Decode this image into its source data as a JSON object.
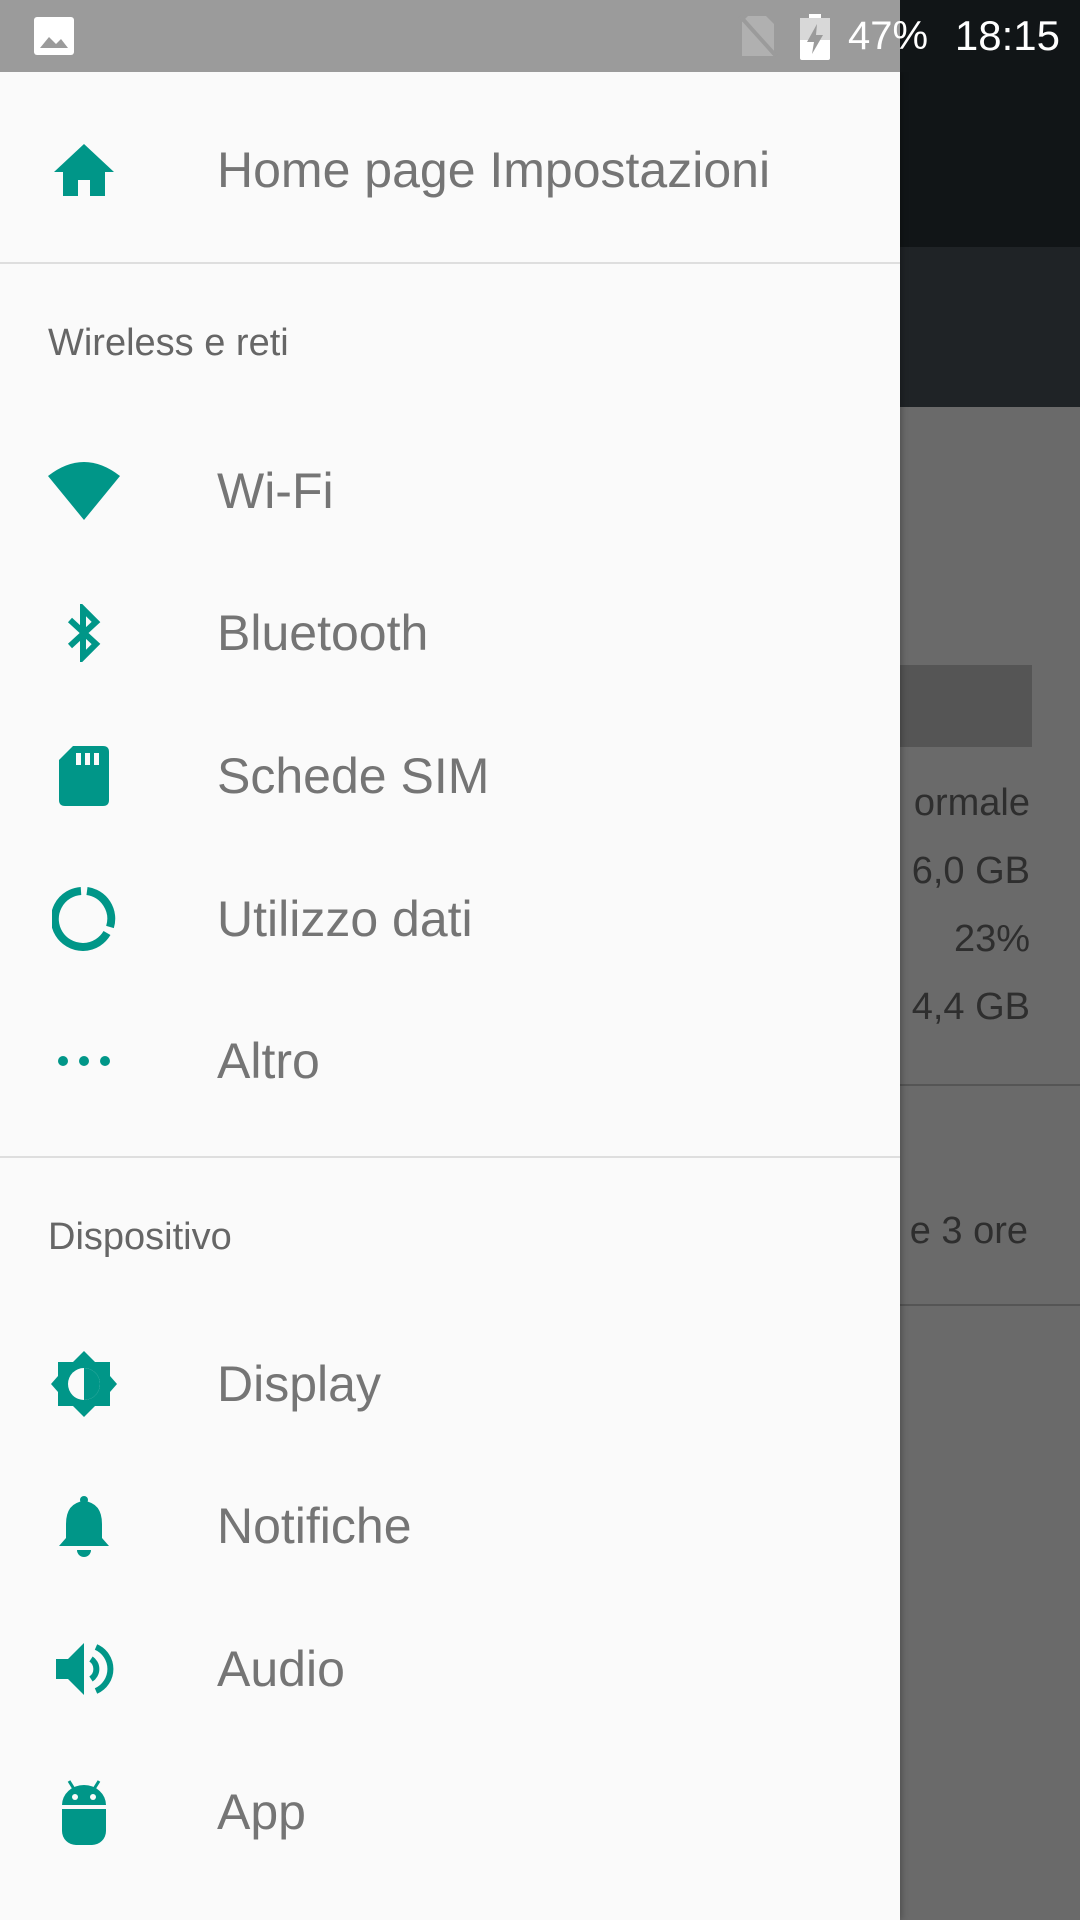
{
  "status_bar": {
    "battery": "47%",
    "time": "18:15",
    "icons": [
      "image-icon",
      "no-sim-icon",
      "battery-charging-icon"
    ]
  },
  "background_app": {
    "lines": [
      "ormale",
      "6,0 GB",
      "23%",
      "4,4 GB"
    ],
    "battery_estimate": "e 3 ore"
  },
  "drawer": {
    "home": {
      "label": "Home page Impostazioni",
      "icon": "home-icon"
    },
    "sections": [
      {
        "header": "Wireless e reti",
        "items": [
          {
            "label": "Wi-Fi",
            "icon": "wifi-icon"
          },
          {
            "label": "Bluetooth",
            "icon": "bluetooth-icon"
          },
          {
            "label": "Schede SIM",
            "icon": "sim-card-icon"
          },
          {
            "label": "Utilizzo dati",
            "icon": "data-usage-icon"
          },
          {
            "label": "Altro",
            "icon": "more-horiz-icon"
          }
        ]
      },
      {
        "header": "Dispositivo",
        "items": [
          {
            "label": "Display",
            "icon": "brightness-icon"
          },
          {
            "label": "Notifiche",
            "icon": "bell-icon"
          },
          {
            "label": "Audio",
            "icon": "volume-icon"
          },
          {
            "label": "App",
            "icon": "android-icon"
          }
        ]
      }
    ]
  },
  "colors": {
    "accent": "#009688",
    "drawer_bg": "#fafafa",
    "label": "#757575",
    "status_bar": "#111517"
  }
}
